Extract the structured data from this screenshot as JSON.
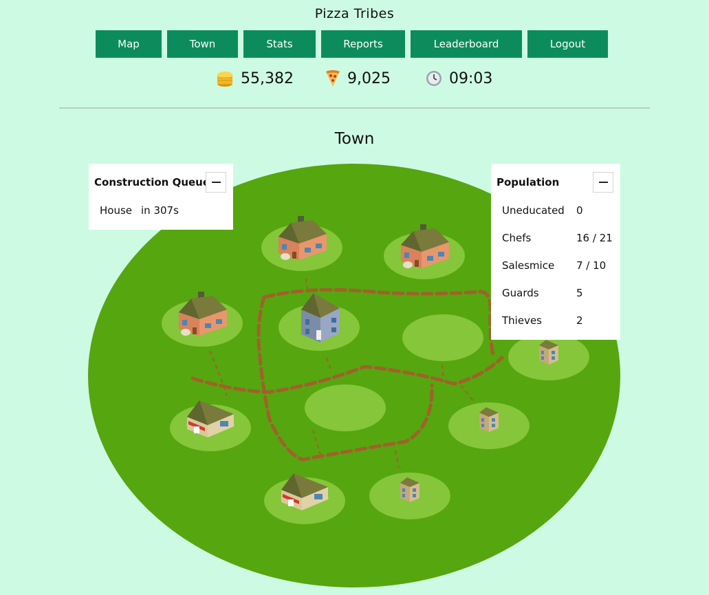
{
  "app_title": "Pizza Tribes",
  "nav": [
    "Map",
    "Town",
    "Stats",
    "Reports",
    "Leaderboard",
    "Logout"
  ],
  "resources": {
    "coins": "55,382",
    "pizzas": "9,025",
    "time": "09:03"
  },
  "icons": {
    "coins": "coin-stack-icon",
    "pizzas": "pizza-slice-icon",
    "time": "clock-icon",
    "minimize": "minus-icon"
  },
  "page_title": "Town",
  "construction_queue": {
    "title": "Construction Queue",
    "items": [
      {
        "building": "House",
        "eta": "in 307s"
      }
    ]
  },
  "population": {
    "title": "Population",
    "rows": [
      {
        "label": "Uneducated",
        "value": "0"
      },
      {
        "label": "Chefs",
        "value": "16 / 21"
      },
      {
        "label": "Salesmice",
        "value": "7 / 10"
      },
      {
        "label": "Guards",
        "value": "5"
      },
      {
        "label": "Thieves",
        "value": "2"
      }
    ]
  },
  "colors": {
    "background": "#cdfae3",
    "nav_button": "#0c8c5c",
    "town_ground": "#56a60f",
    "lot": "#85c63a",
    "path": "#a0612a"
  },
  "lots": [
    {
      "building": "kitchen"
    },
    {
      "building": "kitchen"
    },
    {
      "building": "kitchen"
    },
    {
      "building": "school"
    },
    {
      "building": "empty"
    },
    {
      "building": "house"
    },
    {
      "building": "shop"
    },
    {
      "building": "empty"
    },
    {
      "building": "house"
    },
    {
      "building": "shop"
    },
    {
      "building": "house"
    }
  ]
}
